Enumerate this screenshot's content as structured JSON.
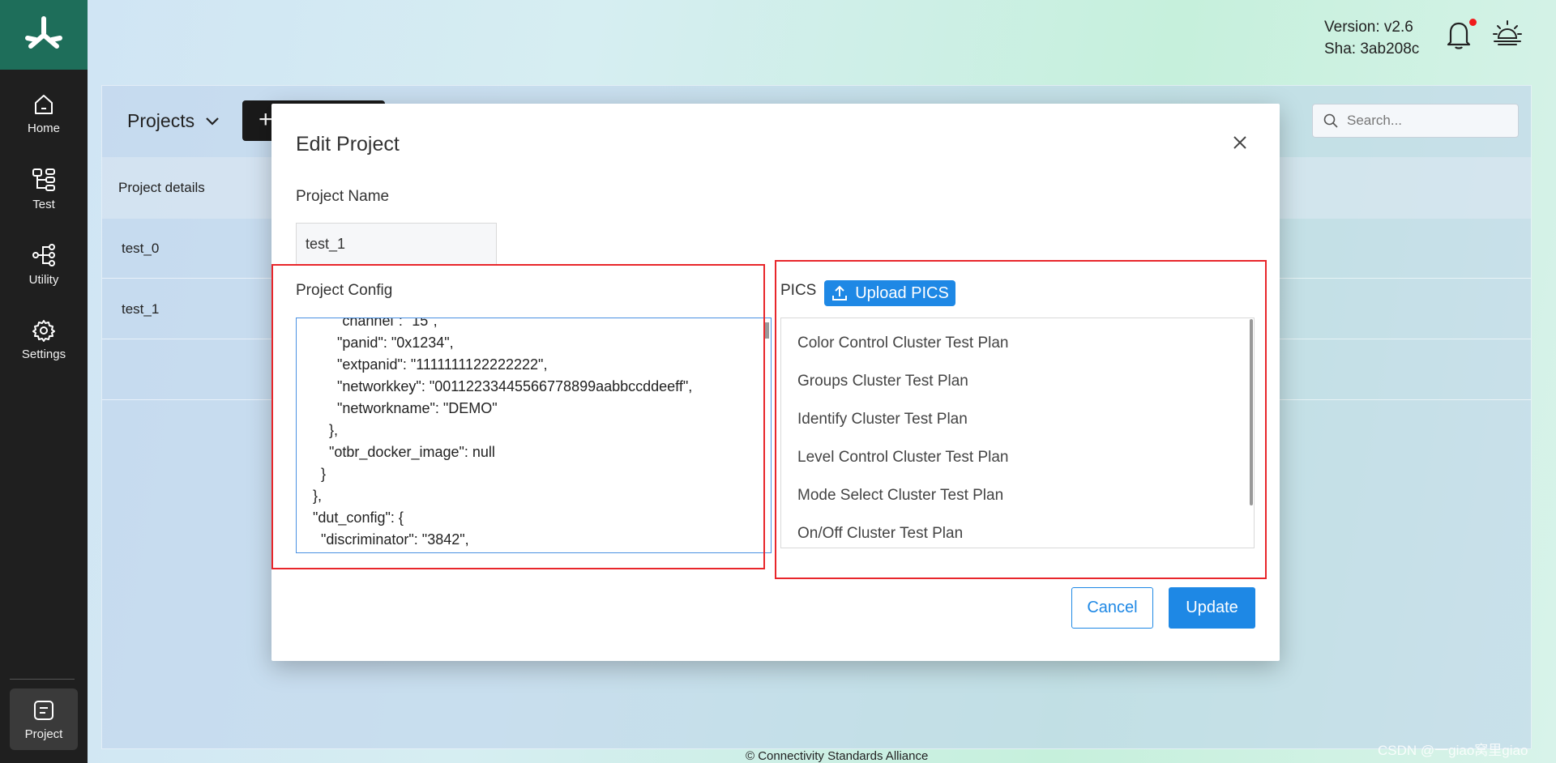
{
  "sidebar": {
    "items": [
      {
        "label": "Home",
        "icon": "home-icon"
      },
      {
        "label": "Test",
        "icon": "test-icon"
      },
      {
        "label": "Utility",
        "icon": "utility-icon"
      },
      {
        "label": "Settings",
        "icon": "gear-icon"
      }
    ],
    "project": {
      "label": "Project",
      "icon": "project-icon"
    }
  },
  "header": {
    "version": "Version: v2.6",
    "sha": "Sha: 3ab208c"
  },
  "page": {
    "title": "Projects",
    "create_label": "+",
    "search_placeholder": "Search...",
    "table_header": "Project details",
    "rows": [
      "test_0",
      "test_1"
    ],
    "footer": "© Connectivity Standards Alliance",
    "watermark": "CSDN @一giao窝里giao"
  },
  "modal": {
    "title": "Edit Project",
    "name_label": "Project Name",
    "name_value": "test_1",
    "config_label": "Project Config",
    "config_text": "          \"channel\": \"15\",\n          \"panid\": \"0x1234\",\n          \"extpanid\": \"1111111122222222\",\n          \"networkkey\": \"00112233445566778899aabbccddeeff\",\n          \"networkname\": \"DEMO\"\n        },\n        \"otbr_docker_image\": null\n      }\n    },\n    \"dut_config\": {\n      \"discriminator\": \"3842\",",
    "pics_label": "PICS",
    "upload_label": "Upload PICS",
    "pics_items": [
      "Color Control Cluster Test Plan",
      "Groups Cluster Test Plan",
      "Identify Cluster Test Plan",
      "Level Control Cluster Test Plan",
      "Mode Select Cluster Test Plan",
      "On/Off Cluster Test Plan"
    ],
    "cancel_label": "Cancel",
    "update_label": "Update"
  },
  "colors": {
    "accent": "#1e88e5",
    "sidebar": "#1f1f1f",
    "logo_bg": "#1e6e5a",
    "annotation": "#e8262b"
  }
}
